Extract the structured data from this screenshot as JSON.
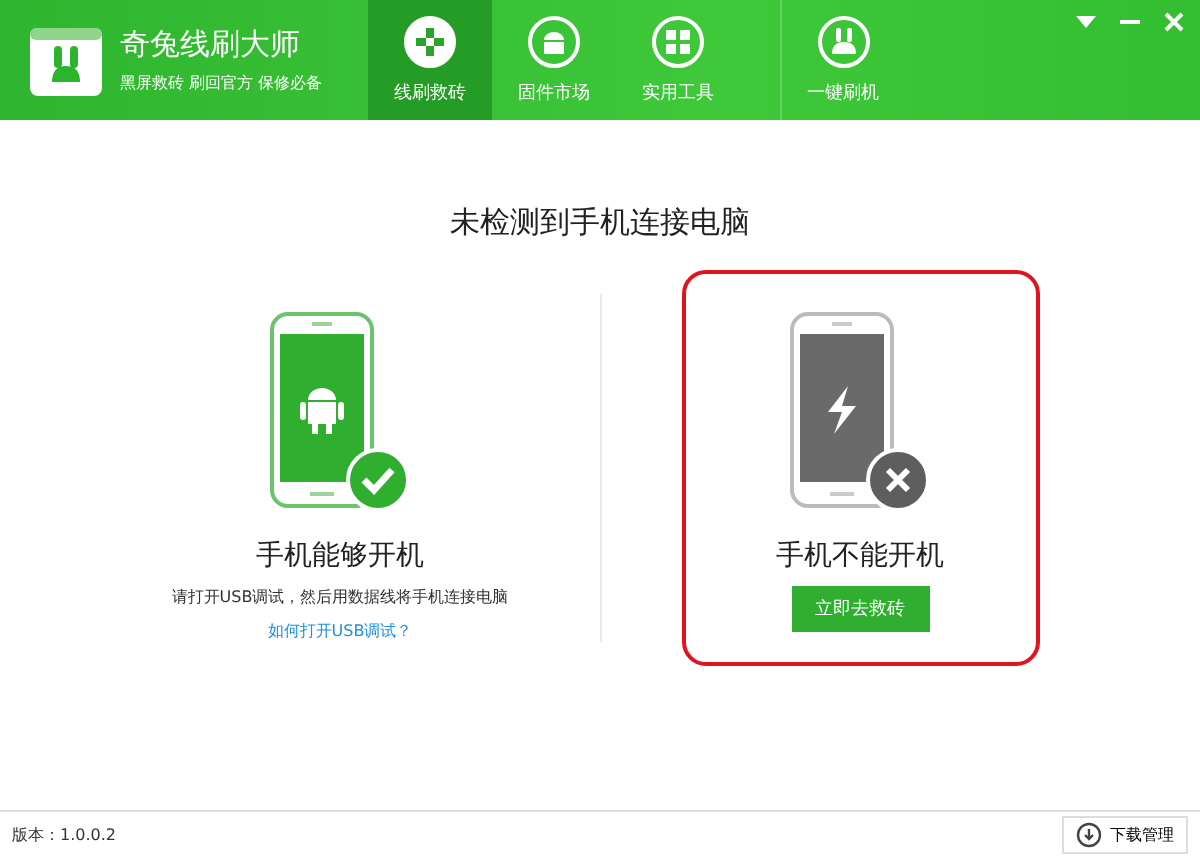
{
  "app": {
    "name": "奇兔线刷大师",
    "slogan": "黑屏救砖 刷回官方 保修必备"
  },
  "tabs": [
    {
      "label": "线刷救砖",
      "kind": "plus",
      "selected": true
    },
    {
      "label": "固件市场",
      "kind": "android",
      "selected": false
    },
    {
      "label": "实用工具",
      "kind": "grid",
      "selected": false
    },
    {
      "label": "一键刷机",
      "kind": "rabbit",
      "selected": false
    }
  ],
  "heading": "未检测到手机连接电脑",
  "options": [
    {
      "kind": "can-boot",
      "title": "手机能够开机",
      "description": "请打开USB调试，然后用数据线将手机连接电脑",
      "link": "如何打开USB调试？",
      "highlighted": false
    },
    {
      "kind": "cannot-boot",
      "title": "手机不能开机",
      "button": "立即去救砖",
      "highlighted": true
    }
  ],
  "status_bar": {
    "version": "版本：1.0.0.2",
    "download_button": "下载管理"
  }
}
